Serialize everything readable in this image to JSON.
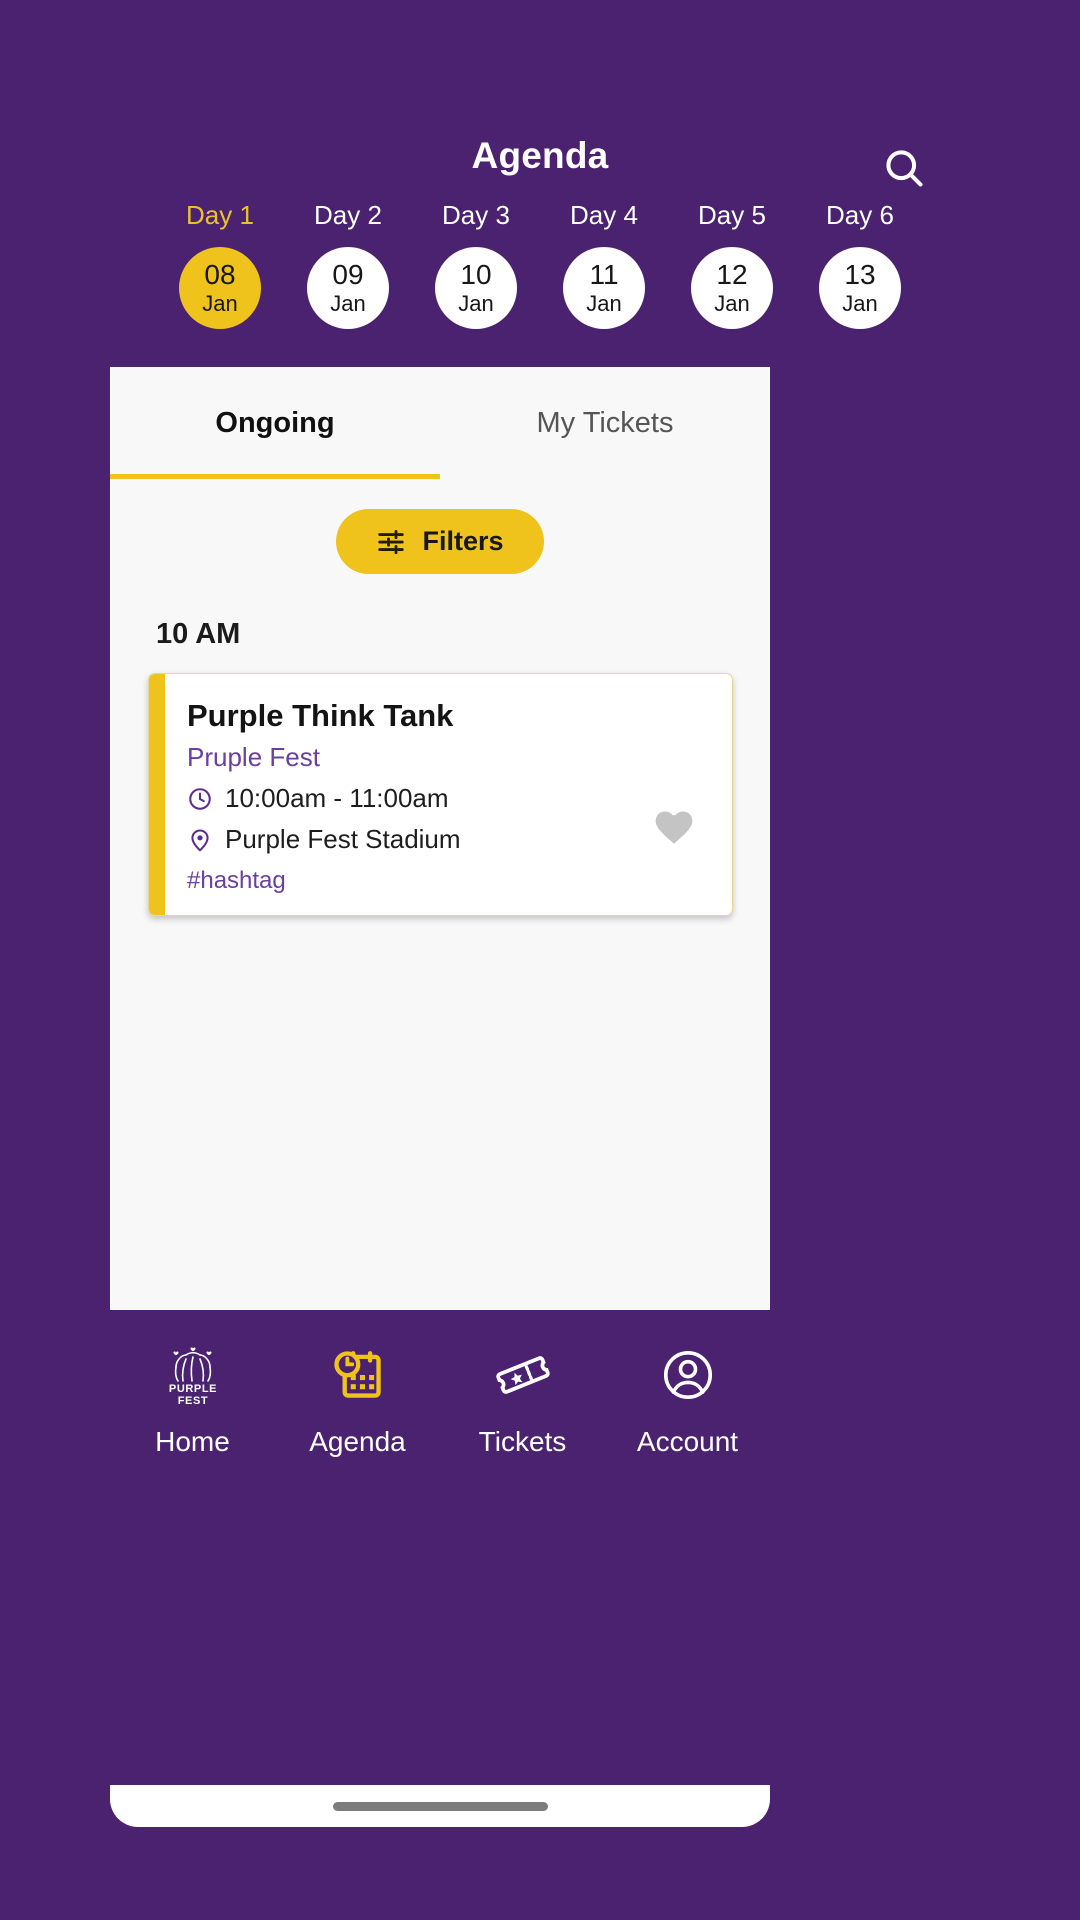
{
  "theme": {
    "purple": "#4A2270",
    "yellow": "#EFC31B",
    "accent_text_purple": "#6B3F9E",
    "sheet_bg": "#F8F8F8",
    "card_bg": "#FFFFFF",
    "heart_gray": "#C4C4C4"
  },
  "header": {
    "title": "Agenda",
    "search_icon": "search-icon"
  },
  "day_selector": {
    "days": [
      {
        "label": "Day 1",
        "date": "08",
        "month": "Jan",
        "active": true
      },
      {
        "label": "Day 2",
        "date": "09",
        "month": "Jan",
        "active": false
      },
      {
        "label": "Day 3",
        "date": "10",
        "month": "Jan",
        "active": false
      },
      {
        "label": "Day 4",
        "date": "11",
        "month": "Jan",
        "active": false
      },
      {
        "label": "Day 5",
        "date": "12",
        "month": "Jan",
        "active": false
      },
      {
        "label": "Day 6",
        "date": "13",
        "month": "Jan",
        "active": false
      }
    ]
  },
  "tabs": [
    {
      "label": "Ongoing",
      "active": true
    },
    {
      "label": "My Tickets",
      "active": false
    }
  ],
  "filters": {
    "label": "Filters",
    "icon": "sliders-icon"
  },
  "schedule": {
    "time_heading": "10 AM",
    "events": [
      {
        "title": "Purple Think Tank",
        "organizer": "Pruple Fest",
        "time_icon": "clock-icon",
        "time": "10:00am - 11:00am",
        "location_icon": "location-pin-icon",
        "location": "Purple Fest Stadium",
        "hashtag": "#hashtag",
        "favorite_icon": "heart-icon",
        "favorited": false
      }
    ]
  },
  "bottom_nav": {
    "items": [
      {
        "label": "Home",
        "icon": "purple-fest-logo-icon",
        "active": false
      },
      {
        "label": "Agenda",
        "icon": "calendar-clock-icon",
        "active": true
      },
      {
        "label": "Tickets",
        "icon": "ticket-icon",
        "active": false
      },
      {
        "label": "Account",
        "icon": "user-circle-icon",
        "active": false
      }
    ]
  },
  "logo": {
    "line1": "PURPLE",
    "line2": "FEST"
  }
}
